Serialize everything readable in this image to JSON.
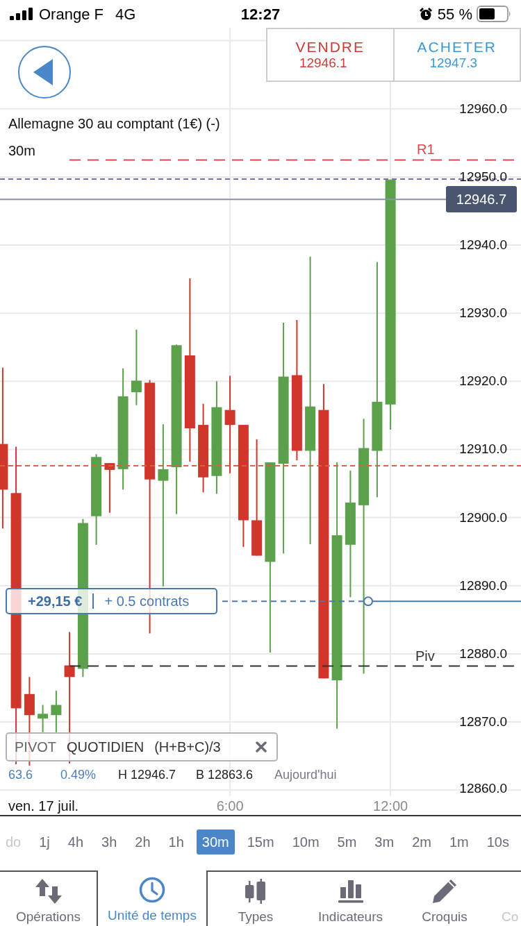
{
  "status_bar": {
    "carrier": "Orange F",
    "network": "4G",
    "time": "12:27",
    "battery": "55 %"
  },
  "quote": {
    "sell": {
      "label": "VENDRE",
      "price": "12946.1"
    },
    "buy": {
      "label": "ACHETER",
      "price": "12947.3"
    }
  },
  "chart": {
    "title": "Allemagne 30 au comptant (1€) (-)",
    "interval": "30m",
    "date_label": "ven. 17 juil.",
    "chart_data": {
      "type": "candlestick",
      "x": [
        -2.5,
        -2,
        -1.5,
        -1,
        -0.5,
        0,
        0.5,
        1,
        1.5,
        2,
        2.5,
        3,
        3.5,
        4,
        4.5,
        5,
        5.5,
        6,
        6.5,
        7,
        7.5,
        8,
        8.5,
        9,
        9.5,
        10,
        10.5,
        11,
        11.5,
        12
      ],
      "ohlc": [
        [
          12910.8,
          12922.0,
          12898.4,
          12904.1
        ],
        [
          12903.6,
          12910.4,
          12863.8,
          12872.0
        ],
        [
          12874.1,
          12876.6,
          12863.6,
          12871.0
        ],
        [
          12870.5,
          12872.5,
          12868.5,
          12871.2
        ],
        [
          12871.0,
          12874.6,
          12868.5,
          12872.5
        ],
        [
          12878.3,
          12883.2,
          12863.9,
          12876.6
        ],
        [
          12877.8,
          12899.8,
          12876.6,
          12899.2
        ],
        [
          12900.2,
          12909.3,
          12896.0,
          12908.9
        ],
        [
          12908.0,
          12908.0,
          12900.7,
          12907.0
        ],
        [
          12907.1,
          12921.9,
          12904.1,
          12917.8
        ],
        [
          12918.4,
          12927.6,
          12916.5,
          12920.1
        ],
        [
          12919.8,
          12920.2,
          12883.0,
          12905.6
        ],
        [
          12905.4,
          12913.7,
          12889.9,
          12907.1
        ],
        [
          12907.4,
          12925.4,
          12900.5,
          12925.3
        ],
        [
          12923.8,
          12935.1,
          12908.2,
          12913.1
        ],
        [
          12913.6,
          12916.7,
          12903.7,
          12905.9
        ],
        [
          12906.1,
          12920.0,
          12903.5,
          12916.2
        ],
        [
          12915.8,
          12920.8,
          12906.5,
          12913.6
        ],
        [
          12913.6,
          12913.6,
          12895.7,
          12899.6
        ],
        [
          12899.6,
          12911.5,
          12894.4,
          12894.4
        ],
        [
          12893.5,
          12908.1,
          12880.2,
          12908.1
        ],
        [
          12907.9,
          12928.6,
          12894.7,
          12920.7
        ],
        [
          12920.9,
          12929.0,
          12908.4,
          12909.8
        ],
        [
          12909.8,
          12938.3,
          12896.1,
          12916.3
        ],
        [
          12915.8,
          12919.6,
          12876.4,
          12876.4
        ],
        [
          12876.1,
          12908.1,
          12869.0,
          12897.4
        ],
        [
          12896.0,
          12906.9,
          12888.3,
          12902.2
        ],
        [
          12901.8,
          12914.5,
          12877.1,
          12910.2
        ],
        [
          12909.8,
          12937.5,
          12903.0,
          12917.0
        ],
        [
          12916.6,
          12949.6,
          12912.9,
          12949.6
        ]
      ],
      "xlim": [
        -2.6,
        16.88
      ],
      "ylim": [
        12859.1,
        12971.9
      ],
      "grid": true,
      "yticks": [
        {
          "value": 12960,
          "label": "12960.0"
        },
        {
          "value": 12950,
          "label": "12950.0"
        },
        {
          "value": 12940,
          "label": "12940.0"
        },
        {
          "value": 12930,
          "label": "12930.0"
        },
        {
          "value": 12920,
          "label": "12920.0"
        },
        {
          "value": 12910,
          "label": "12910.0"
        },
        {
          "value": 12900,
          "label": "12900.0"
        },
        {
          "value": 12890,
          "label": "12890.0"
        },
        {
          "value": 12880,
          "label": "12880.0"
        },
        {
          "value": 12870,
          "label": "12870.0"
        },
        {
          "value": 12860,
          "label": "12860.0"
        }
      ],
      "xticks": [
        {
          "value": 6,
          "label": "6:00"
        },
        {
          "value": 12,
          "label": "12:00"
        }
      ],
      "ref_lines": [
        {
          "axis": "y",
          "value": 12952.5,
          "label": "R1"
        },
        {
          "axis": "y",
          "value": 12949.7
        },
        {
          "axis": "y",
          "value": 12946.7,
          "label": "12946.7"
        },
        {
          "axis": "y",
          "value": 12907.6
        },
        {
          "axis": "y",
          "value": 12887.7
        },
        {
          "axis": "y",
          "value": 12878.2,
          "label": "Piv"
        }
      ]
    },
    "position": {
      "profit": "+29,15 €",
      "size": "+ 0.5 contrats"
    },
    "indicator": {
      "name": "PIVOT",
      "period": "QUOTIDIEN",
      "formula": "(H+B+C)/3"
    },
    "stats": {
      "change": "63.6",
      "change_percent": "0.49%",
      "high": "H 12946.7",
      "low": "B 12863.6",
      "period": "Aujourd'hui"
    }
  },
  "timeframes": [
    {
      "label": "do",
      "selected": false,
      "dimmed": true
    },
    {
      "label": "1j",
      "selected": false,
      "dimmed": false
    },
    {
      "label": "4h",
      "selected": false,
      "dimmed": false
    },
    {
      "label": "3h",
      "selected": false,
      "dimmed": false
    },
    {
      "label": "2h",
      "selected": false,
      "dimmed": false
    },
    {
      "label": "1h",
      "selected": false,
      "dimmed": false
    },
    {
      "label": "30m",
      "selected": true,
      "dimmed": false
    },
    {
      "label": "15m",
      "selected": false,
      "dimmed": false
    },
    {
      "label": "10m",
      "selected": false,
      "dimmed": false
    },
    {
      "label": "5m",
      "selected": false,
      "dimmed": false
    },
    {
      "label": "3m",
      "selected": false,
      "dimmed": false
    },
    {
      "label": "2m",
      "selected": false,
      "dimmed": false
    },
    {
      "label": "1m",
      "selected": false,
      "dimmed": false
    },
    {
      "label": "10s",
      "selected": false,
      "dimmed": false
    }
  ],
  "bottom_nav": [
    {
      "label": "Opérations",
      "selected": false,
      "dimmed": false
    },
    {
      "label": "Unité de temps",
      "selected": true,
      "dimmed": false
    },
    {
      "label": "Types",
      "selected": false,
      "dimmed": false
    },
    {
      "label": "Indicateurs",
      "selected": false,
      "dimmed": false
    },
    {
      "label": "Croquis",
      "selected": false,
      "dimmed": false
    },
    {
      "label": "Co",
      "selected": false,
      "dimmed": true
    }
  ]
}
